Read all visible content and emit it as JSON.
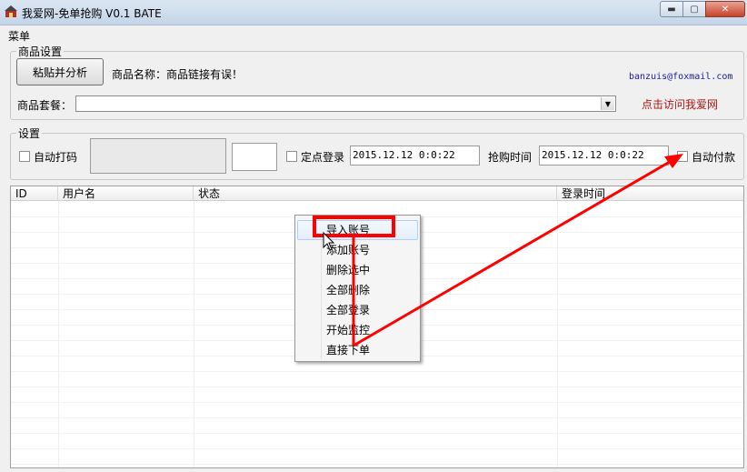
{
  "window": {
    "title": "我爱网-免单抢购 V0.1 BATE",
    "min_glyph": "▬",
    "max_glyph": "▢",
    "close_glyph": "✕"
  },
  "menubar": {
    "menu": "菜单"
  },
  "product_group": {
    "legend": "商品设置",
    "paste_button": "粘贴并分析",
    "product_name_label": "商品名称：",
    "product_name_value": "商品链接有误！",
    "email": "banzuis@foxmail.com",
    "package_label": "商品套餐：",
    "package_value": "",
    "visit_link": "点击访问我爱网"
  },
  "settings_group": {
    "legend": "设置",
    "auto_captcha_label": "自动打码",
    "scheduled_login_label": "定点登录",
    "scheduled_login_time": "2015.12.12 0:0:22",
    "purchase_time_label": "抢购时间",
    "purchase_time": "2015.12.12 0:0:22",
    "auto_pay_label": "自动付款",
    "captcha_input": ""
  },
  "table": {
    "columns": [
      "ID",
      "用户名",
      "状态",
      "登录时间"
    ],
    "rows": []
  },
  "context_menu": {
    "items": [
      "导入账号",
      "添加账号",
      "删除选中",
      "全部删除",
      "全部登录",
      "开始监控",
      "直接下单"
    ],
    "highlighted_index": 0
  },
  "colors": {
    "annotation": "#ff0000",
    "email": "#1a1aa0",
    "link": "#b01414"
  },
  "icons": {
    "app": "app-icon",
    "dropdown": "chevron-down-icon",
    "cursor": "mouse-pointer-icon"
  }
}
